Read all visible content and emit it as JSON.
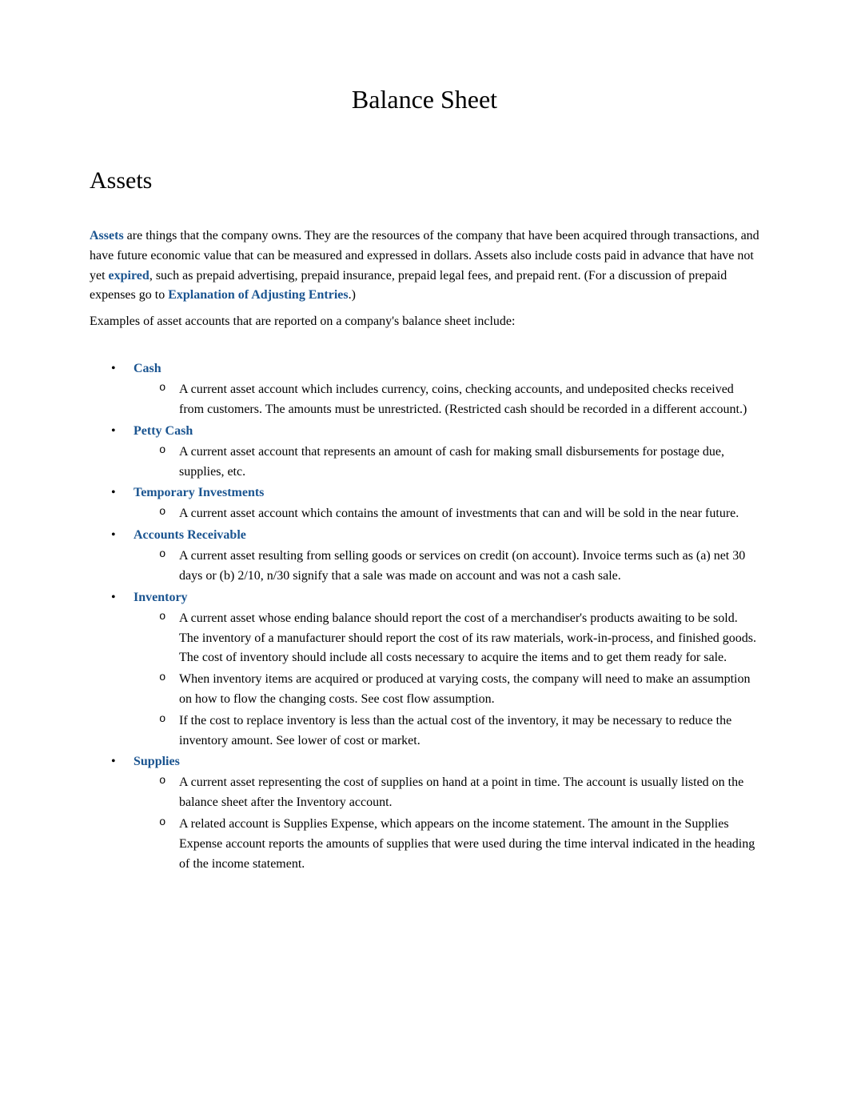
{
  "title": "Balance Sheet",
  "section_heading": "Assets",
  "intro": {
    "link_assets": "Assets",
    "text1": " are things that the company owns. They are the resources of the company that have been acquired through transactions, and have future economic value that can be measured and expressed in dollars. Assets also include costs paid in advance that have not yet ",
    "link_expired": "expired",
    "text2": ", such as prepaid advertising, prepaid insurance, prepaid legal fees, and prepaid rent. (For a discussion of prepaid expenses go to ",
    "link_explanation": "Explanation of Adjusting Entries",
    "text3": ".)"
  },
  "examples_intro": "Examples of asset accounts that are reported on a company's balance sheet include:",
  "items": [
    {
      "title": "Cash",
      "descriptions": [
        "A current asset account which includes currency, coins, checking accounts, and undeposited checks received from customers. The amounts must be unrestricted. (Restricted cash should be recorded in a different account.)"
      ]
    },
    {
      "title": "Petty Cash",
      "descriptions": [
        "A current asset account that represents an amount of cash for making small disbursements for postage due, supplies, etc."
      ]
    },
    {
      "title": "Temporary Investments",
      "descriptions": [
        "A current asset account which contains the amount of investments that can and will be sold in the near future."
      ]
    },
    {
      "title": "Accounts Receivable",
      "descriptions": [
        "A current asset resulting from selling goods or services on credit (on account). Invoice terms such as (a) net 30 days or (b) 2/10, n/30 signify that a sale was made on account and was not a cash sale."
      ]
    },
    {
      "title": "Inventory",
      "descriptions": [
        "A current asset whose ending balance should report the cost of a merchandiser's products awaiting to be sold. The inventory of a manufacturer should report the cost of its raw materials, work-in-process, and finished goods. The cost of inventory should include all costs necessary to acquire the items and to get them ready for sale.",
        "When inventory items are acquired or produced at varying costs, the company will need to make an assumption on how to flow the changing costs. See cost flow assumption.",
        "If the cost to replace inventory is less than the actual cost of the inventory, it may be necessary to reduce the inventory amount. See lower of cost or market."
      ]
    },
    {
      "title": "Supplies",
      "descriptions": [
        "A current asset representing the cost of supplies on hand at a point in time. The account is usually listed on the balance sheet after the Inventory account.",
        "A related account is Supplies Expense, which appears on the income statement. The amount in the Supplies Expense account reports the amounts of supplies that were used during the time interval indicated in the heading of the income statement."
      ]
    }
  ]
}
